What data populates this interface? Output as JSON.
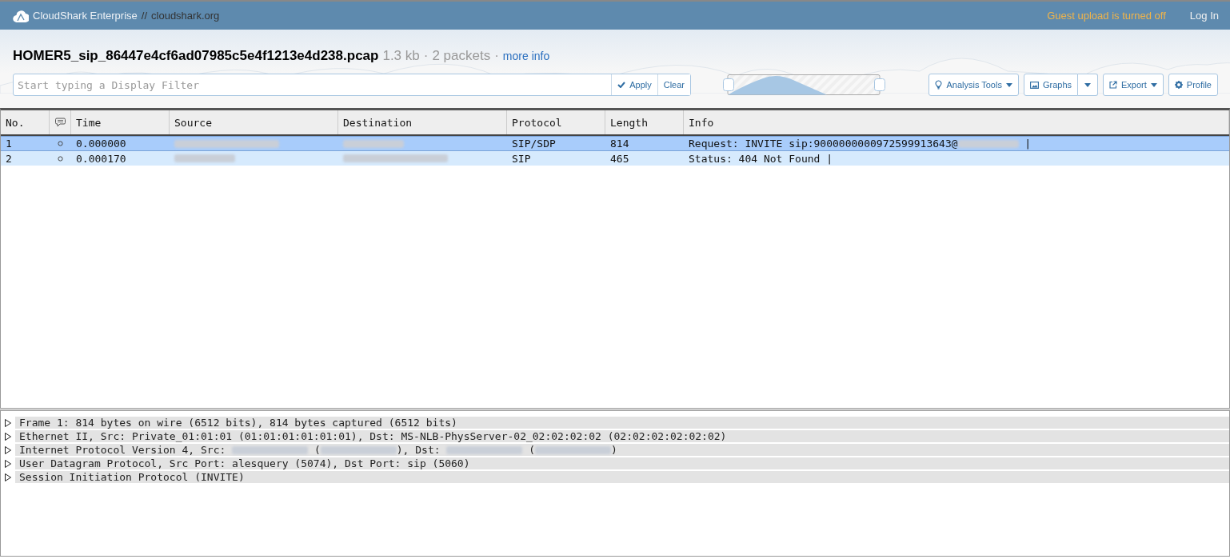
{
  "topbar": {
    "brand": "CloudShark Enterprise",
    "separator": "//",
    "site": "cloudshark.org",
    "notice": "Guest upload is turned off",
    "login": "Log In"
  },
  "file": {
    "name": "HOMER5_sip_86447e4cf6ad07985c5e4f1213e4d238.pcap",
    "size": "1.3 kb",
    "dot1": "·",
    "packets": "2 packets",
    "dot2": "·",
    "more": "more info"
  },
  "filter": {
    "placeholder": "Start typing a Display Filter",
    "apply": "Apply",
    "clear": "Clear"
  },
  "tools": [
    {
      "kind": "menu",
      "label": "Analysis Tools"
    },
    {
      "kind": "split",
      "label": "Graphs"
    },
    {
      "kind": "menu",
      "label": "Export"
    },
    {
      "kind": "plain",
      "label": "Profile"
    }
  ],
  "table": {
    "columns": [
      "No.",
      "",
      "Time",
      "Source",
      "Destination",
      "Protocol",
      "Length",
      "Info"
    ],
    "rows": [
      {
        "selected": true,
        "no": "1",
        "time": "0.000000",
        "source": {
          "redacted": true
        },
        "destination": {
          "redacted": true
        },
        "protocol": "SIP/SDP",
        "length": "814",
        "info": [
          {
            "kind": "text",
            "text": "Request: INVITE sip:9000000000972599913643@"
          },
          {
            "kind": "redacted"
          },
          {
            "kind": "text",
            "text": " |"
          }
        ]
      },
      {
        "selected": false,
        "no": "2",
        "time": "0.000170",
        "source": {
          "redacted": true
        },
        "destination": {
          "redacted": true
        },
        "protocol": "SIP",
        "length": "465",
        "info": [
          {
            "kind": "text",
            "text": "Status: 404 Not Found |"
          }
        ]
      }
    ]
  },
  "details": [
    {
      "expanded": false,
      "segments": [
        {
          "kind": "text",
          "text": "Frame 1: 814 bytes on wire (6512 bits), 814 bytes captured (6512 bits)"
        }
      ]
    },
    {
      "expanded": false,
      "segments": [
        {
          "kind": "text",
          "text": "Ethernet II, Src: Private_01:01:01 (01:01:01:01:01:01), Dst: MS-NLB-PhysServer-02_02:02:02:02 (02:02:02:02:02:02)"
        }
      ]
    },
    {
      "expanded": false,
      "segments": [
        {
          "kind": "text",
          "text": "Internet Protocol Version 4, Src: "
        },
        {
          "kind": "redacted"
        },
        {
          "kind": "text",
          "text": " ("
        },
        {
          "kind": "redacted"
        },
        {
          "kind": "text",
          "text": "), Dst: "
        },
        {
          "kind": "redacted"
        },
        {
          "kind": "text",
          "text": " ("
        },
        {
          "kind": "redacted"
        },
        {
          "kind": "text",
          "text": ")"
        }
      ]
    },
    {
      "expanded": false,
      "segments": [
        {
          "kind": "text",
          "text": "User Datagram Protocol, Src Port: alesquery (5074), Dst Port: sip (5060)"
        }
      ]
    },
    {
      "expanded": false,
      "segments": [
        {
          "kind": "text",
          "text": "Session Initiation Protocol (INVITE)"
        }
      ]
    }
  ]
}
